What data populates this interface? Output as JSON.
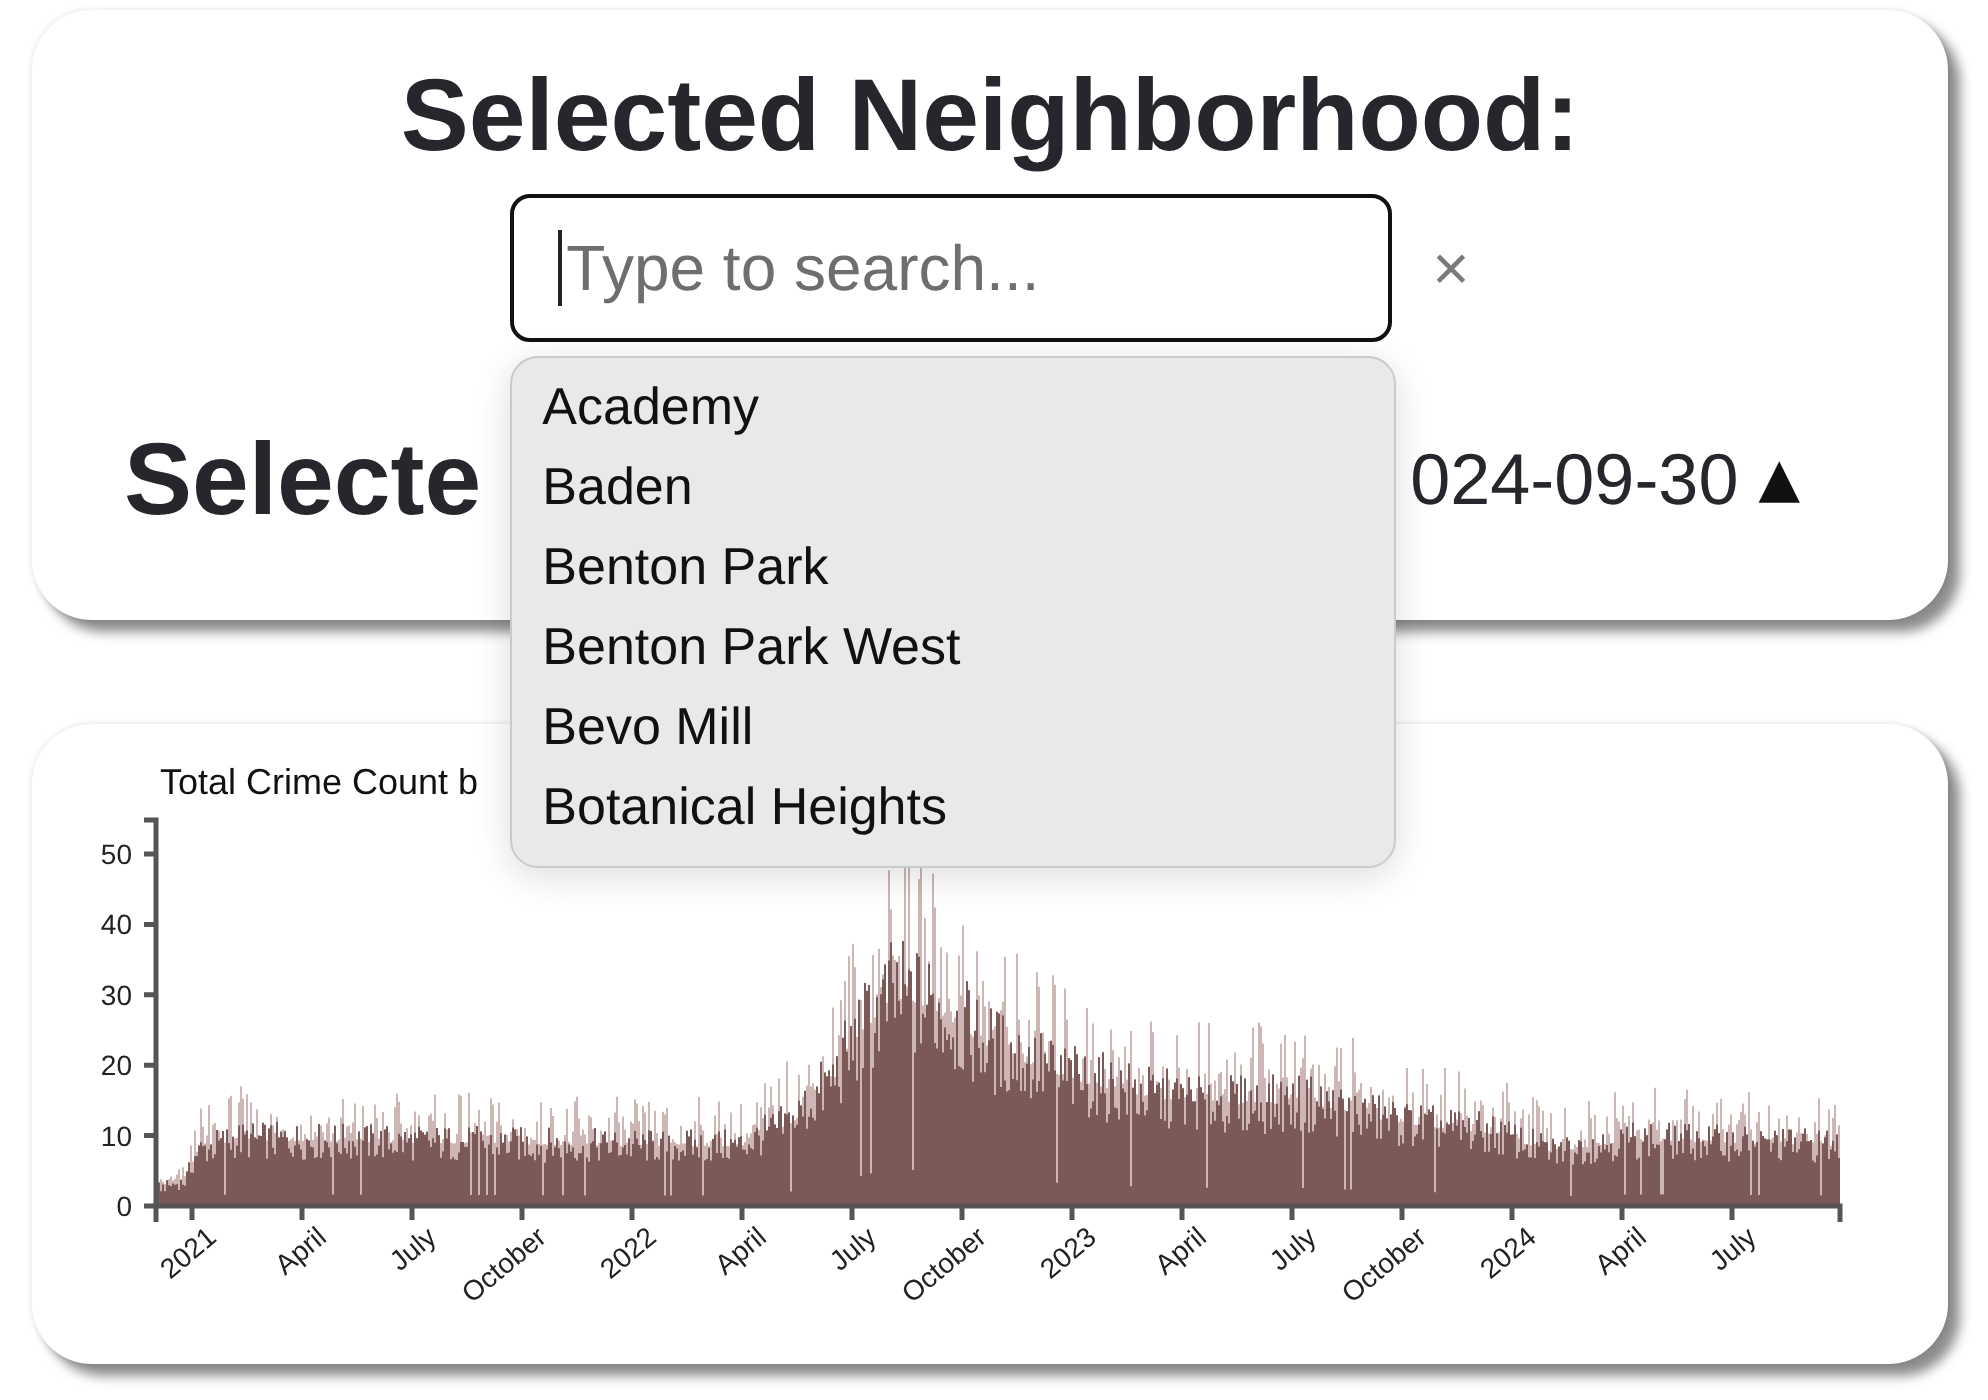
{
  "top_panel": {
    "title": "Selected Neighborhood:",
    "search": {
      "placeholder": "Type to search...",
      "focused": true
    },
    "clear_button": "×",
    "date_line": {
      "label": "Selecte",
      "date": "024-09-30",
      "toggle": "▲"
    },
    "dropdown": {
      "options": [
        {
          "label": "Academy",
          "selected": false
        },
        {
          "label": "Baden",
          "selected": false
        },
        {
          "label": "Benton Park",
          "selected": false
        },
        {
          "label": "Benton Park West",
          "selected": false
        },
        {
          "label": "Bevo Mill",
          "selected": false
        },
        {
          "label": "Botanical Heights",
          "selected": false
        }
      ]
    }
  },
  "chart_panel": {
    "title": "Total Crime Count b",
    "y_tick_labels": [
      "50",
      "40",
      "30",
      "20",
      "10",
      "0"
    ],
    "x_tick_labels": [
      "2021",
      "April",
      "July",
      "October",
      "2022",
      "April",
      "July",
      "October",
      "2023",
      "April",
      "July",
      "October",
      "2024",
      "April",
      "July"
    ]
  }
}
